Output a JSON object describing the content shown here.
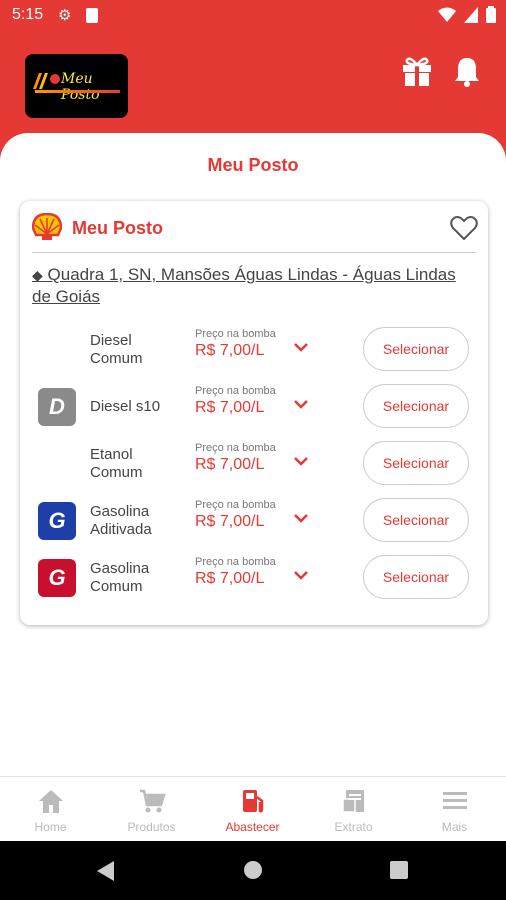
{
  "status_bar": {
    "time": "5:15"
  },
  "header": {
    "logo_text": "Meu Posto"
  },
  "page": {
    "title": "Meu Posto"
  },
  "station": {
    "name": "Meu Posto",
    "address": "Quadra 1, SN, Mansões Águas Lindas - Águas Lindas de Goiás"
  },
  "fuels": [
    {
      "name": "Diesel Comum",
      "badge": "",
      "badge_color": "",
      "price_label": "Preço na bomba",
      "price": "R$ 7,00/L",
      "button": "Selecionar"
    },
    {
      "name": "Diesel s10",
      "badge": "D",
      "badge_color": "#8a8a8a",
      "price_label": "Preço na bomba",
      "price": "R$ 7,00/L",
      "button": "Selecionar"
    },
    {
      "name": "Etanol Comum",
      "badge": "",
      "badge_color": "",
      "price_label": "Preço na bomba",
      "price": "R$ 7,00/L",
      "button": "Selecionar"
    },
    {
      "name": "Gasolina Aditivada",
      "badge": "G",
      "badge_color": "#1e3fa8",
      "price_label": "Preço na bomba",
      "price": "R$ 7,00/L",
      "button": "Selecionar"
    },
    {
      "name": "Gasolina Comum",
      "badge": "G",
      "badge_color": "#c8102e",
      "price_label": "Preço na bomba",
      "price": "R$ 7,00/L",
      "button": "Selecionar"
    }
  ],
  "bottom_nav": {
    "items": [
      {
        "label": "Home",
        "icon": "home-icon"
      },
      {
        "label": "Produtos",
        "icon": "cart-icon"
      },
      {
        "label": "Abastecer",
        "icon": "fuel-pump-icon"
      },
      {
        "label": "Extrato",
        "icon": "extract-icon"
      },
      {
        "label": "Mais",
        "icon": "menu-icon"
      }
    ],
    "active": "Abastecer"
  },
  "colors": {
    "primary": "#e53935",
    "inactive": "#bbbbbb"
  }
}
